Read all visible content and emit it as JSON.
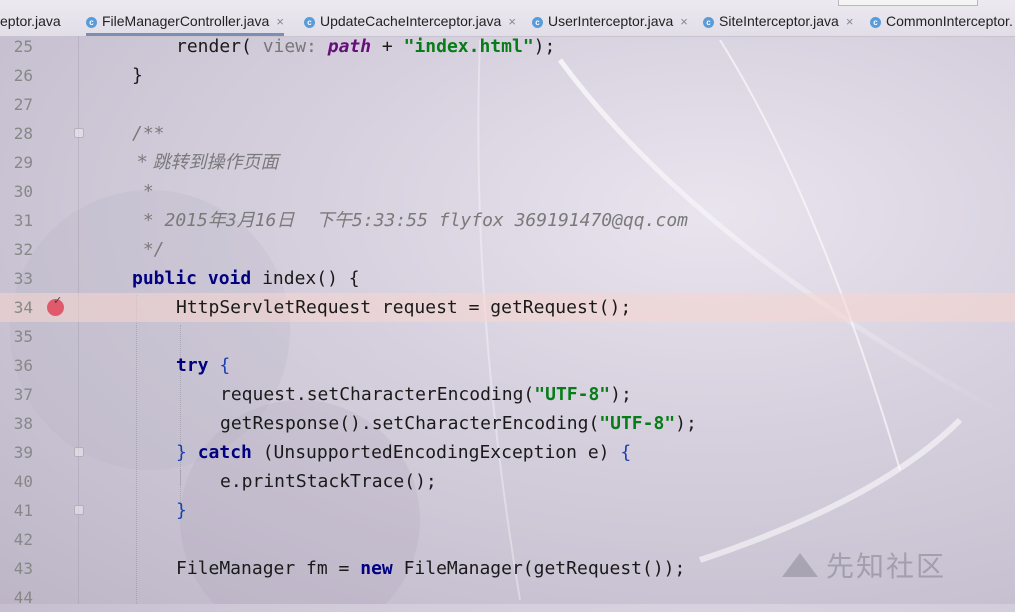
{
  "tabs": [
    {
      "label": "eptor.java",
      "active": false,
      "show_icon": false,
      "show_close": false
    },
    {
      "label": "FileManagerController.java",
      "active": true,
      "show_icon": true,
      "show_close": true
    },
    {
      "label": "UpdateCacheInterceptor.java",
      "active": false,
      "show_icon": true,
      "show_close": true
    },
    {
      "label": "UserInterceptor.java",
      "active": false,
      "show_icon": true,
      "show_close": true
    },
    {
      "label": "SiteInterceptor.java",
      "active": false,
      "show_icon": true,
      "show_close": true
    },
    {
      "label": "CommonInterceptor.",
      "active": false,
      "show_icon": true,
      "show_close": false
    }
  ],
  "tab_icon_glyph": "c",
  "tab_close_glyph": "×",
  "lines": [
    {
      "num": "25"
    },
    {
      "num": "26"
    },
    {
      "num": "27"
    },
    {
      "num": "28"
    },
    {
      "num": "29"
    },
    {
      "num": "30"
    },
    {
      "num": "31"
    },
    {
      "num": "32"
    },
    {
      "num": "33"
    },
    {
      "num": "34"
    },
    {
      "num": "35"
    },
    {
      "num": "36"
    },
    {
      "num": "37"
    },
    {
      "num": "38"
    },
    {
      "num": "39"
    },
    {
      "num": "40"
    },
    {
      "num": "41"
    },
    {
      "num": "42"
    },
    {
      "num": "43"
    },
    {
      "num": "44"
    }
  ],
  "code": {
    "l25_a": "render( ",
    "l25_hint": "view: ",
    "l25_var": "path",
    "l25_op": " + ",
    "l25_str": "\"index.html\"",
    "l25_end": ");",
    "l26": "}",
    "l28": "/**",
    "l29": " * 跳转到操作页面",
    "l30": " *",
    "l31": " * 2015年3月16日  下午5:33:55 flyfox 369191470@qq.com",
    "l32": " */",
    "l33_kw1": "public",
    "l33_kw2": "void",
    "l33_rest": " index() {",
    "l34": "HttpServletRequest request = getRequest();",
    "l36_kw": "try",
    "l36_brace": " {",
    "l37_a": "request.setCharacterEncoding(",
    "l37_str": "\"UTF-8\"",
    "l37_end": ");",
    "l38_a": "getResponse().setCharacterEncoding(",
    "l38_str": "\"UTF-8\"",
    "l38_end": ");",
    "l39_b1": "} ",
    "l39_kw": "catch",
    "l39_rest": " (UnsupportedEncodingException e) ",
    "l39_b2": "{",
    "l40": "e.printStackTrace();",
    "l41": "}",
    "l43_a": "FileManager fm = ",
    "l43_kw": "new",
    "l43_rest": " FileManager(getRequest());"
  },
  "watermark": "先知社区",
  "colors": {
    "keyword": "#000080",
    "string": "#067d17",
    "comment": "#7a7a7a",
    "breakpoint": "#e05a6b",
    "tab_underline": "#7a8fb5"
  }
}
